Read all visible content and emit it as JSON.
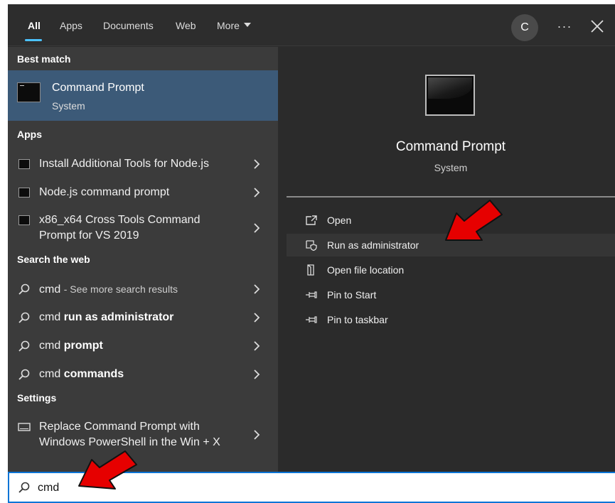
{
  "tabs": [
    {
      "label": "All",
      "active": true
    },
    {
      "label": "Apps"
    },
    {
      "label": "Documents"
    },
    {
      "label": "Web"
    },
    {
      "label": "More"
    }
  ],
  "header": {
    "avatar_initial": "C",
    "more_options": "···"
  },
  "best_match": {
    "section": "Best match",
    "title": "Command Prompt",
    "subtitle": "System"
  },
  "apps": {
    "section": "Apps",
    "items": [
      {
        "line1": "Install Additional Tools for Node.js"
      },
      {
        "line1": "Node.js command prompt"
      },
      {
        "line1": "x86_x64 Cross Tools Command",
        "line2": "Prompt for VS 2019"
      }
    ]
  },
  "web": {
    "section": "Search the web",
    "items": [
      {
        "query": "cmd",
        "suffix": "- See more search results"
      },
      {
        "query": "cmd",
        "bold": "run as administrator"
      },
      {
        "query": "cmd",
        "bold": "prompt"
      },
      {
        "query": "cmd",
        "bold": "commands"
      }
    ]
  },
  "settings": {
    "section": "Settings",
    "items": [
      {
        "line1": "Replace Command Prompt with",
        "line2": "Windows PowerShell in the Win + X"
      }
    ]
  },
  "preview": {
    "title": "Command Prompt",
    "subtitle": "System",
    "actions": [
      {
        "label": "Open",
        "icon": "open-icon"
      },
      {
        "label": "Run as administrator",
        "icon": "shield-icon"
      },
      {
        "label": "Open file location",
        "icon": "file-location-icon"
      },
      {
        "label": "Pin to Start",
        "icon": "pin-icon"
      },
      {
        "label": "Pin to taskbar",
        "icon": "pin-icon"
      }
    ]
  },
  "search": {
    "value": "cmd"
  },
  "colors": {
    "accent": "#4cc2ff",
    "selected_row": "#3c5a78",
    "annotation_arrow": "#e60000",
    "search_border": "#0b74d6"
  }
}
